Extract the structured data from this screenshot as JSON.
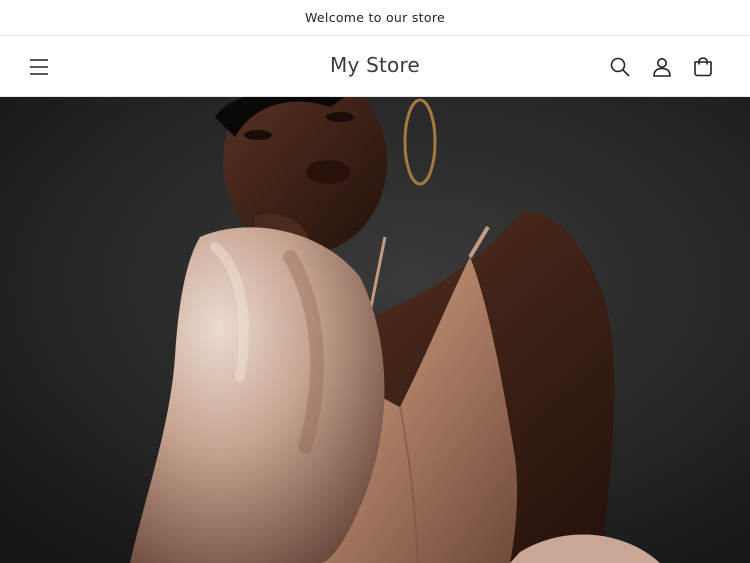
{
  "announcement": {
    "text": "Welcome to our store"
  },
  "header": {
    "store_name": "My Store",
    "icons": {
      "menu": "menu-icon",
      "search": "search-icon",
      "account": "account-icon",
      "cart": "cart-icon"
    }
  },
  "hero": {
    "image": "woman-in-satin-slip-dress-and-fur-coat-photo"
  },
  "colors": {
    "text": "#121212",
    "border": "#e6e6e6",
    "hero_background": "#2a2a2a"
  }
}
